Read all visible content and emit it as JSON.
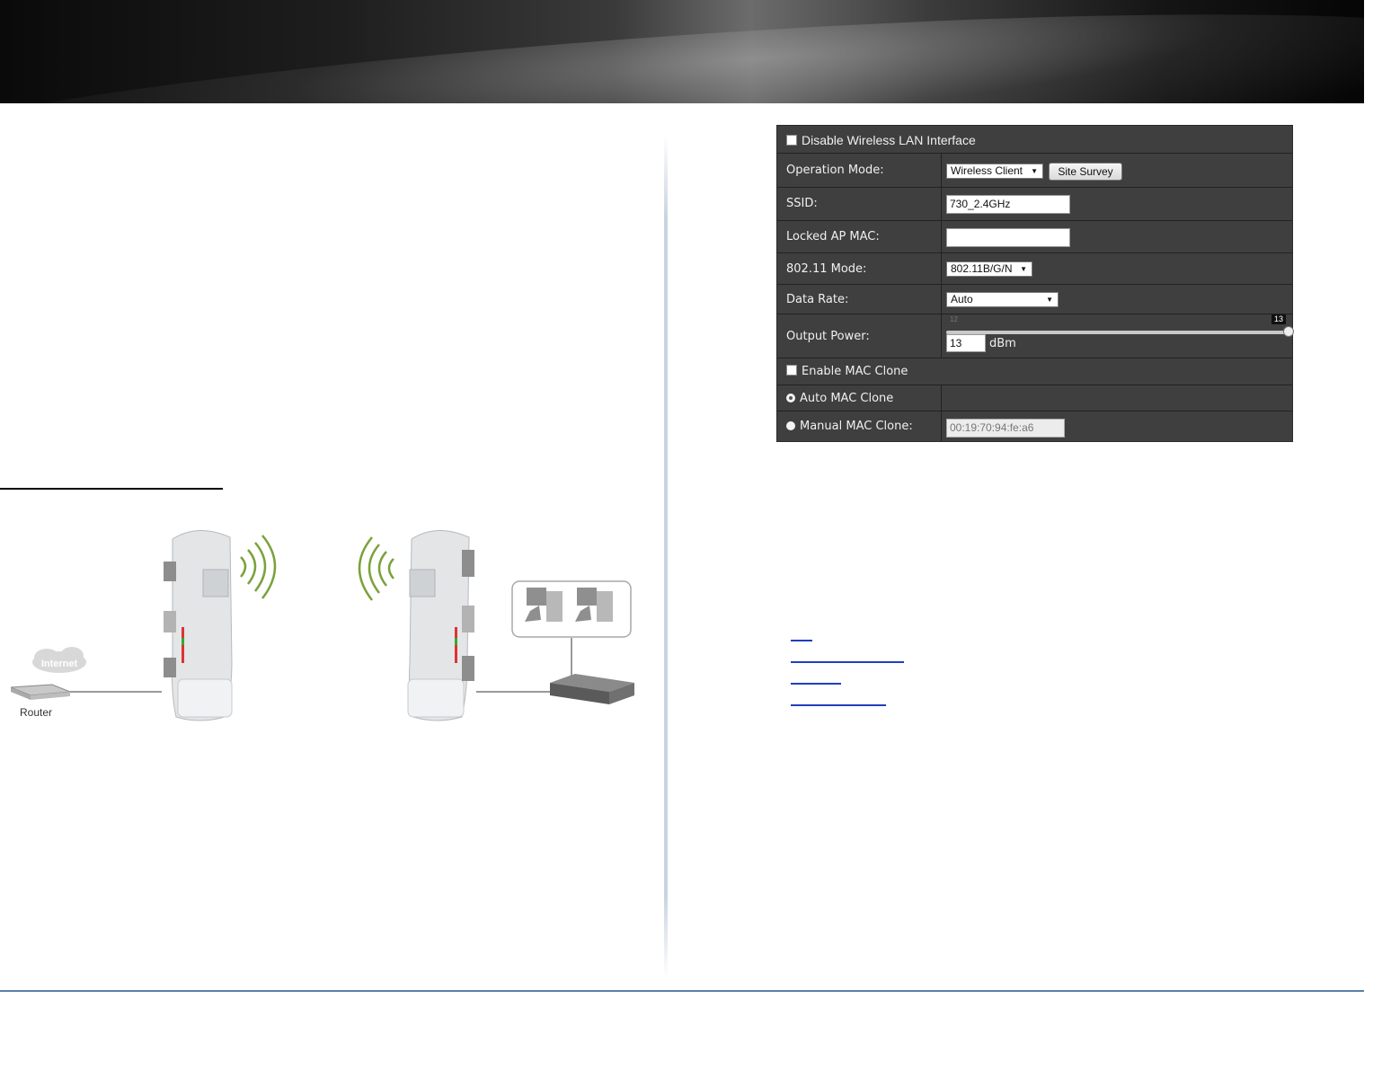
{
  "panel": {
    "disable_wlan_label": "Disable Wireless LAN Interface",
    "operation_mode_label": "Operation Mode:",
    "operation_mode_value": "Wireless Client",
    "site_survey_label": "Site Survey",
    "ssid_label": "SSID:",
    "ssid_value": "730_2.4GHz",
    "locked_ap_mac_label": "Locked AP MAC:",
    "locked_ap_mac_value": "",
    "mode_label": "802.11 Mode:",
    "mode_value": "802.11B/G/N",
    "data_rate_label": "Data Rate:",
    "data_rate_value": "Auto",
    "output_power_label": "Output Power:",
    "output_power_min": "12",
    "output_power_max": "13",
    "output_power_value": "13",
    "output_power_unit": "dBm",
    "enable_mac_clone_label": "Enable MAC Clone",
    "auto_mac_clone_label": "Auto MAC Clone",
    "manual_mac_clone_label": "Manual MAC Clone:",
    "manual_mac_clone_value": "00:19:70:94:fe:a6"
  },
  "diagram": {
    "cloud_label": "Internet",
    "router_label": "Router"
  },
  "colors": {
    "panel_bg": "#3f3f3f",
    "signal_green": "#7aa23a",
    "link_blue": "#1f3fbf",
    "footer_rule": "#5b7fa6"
  }
}
